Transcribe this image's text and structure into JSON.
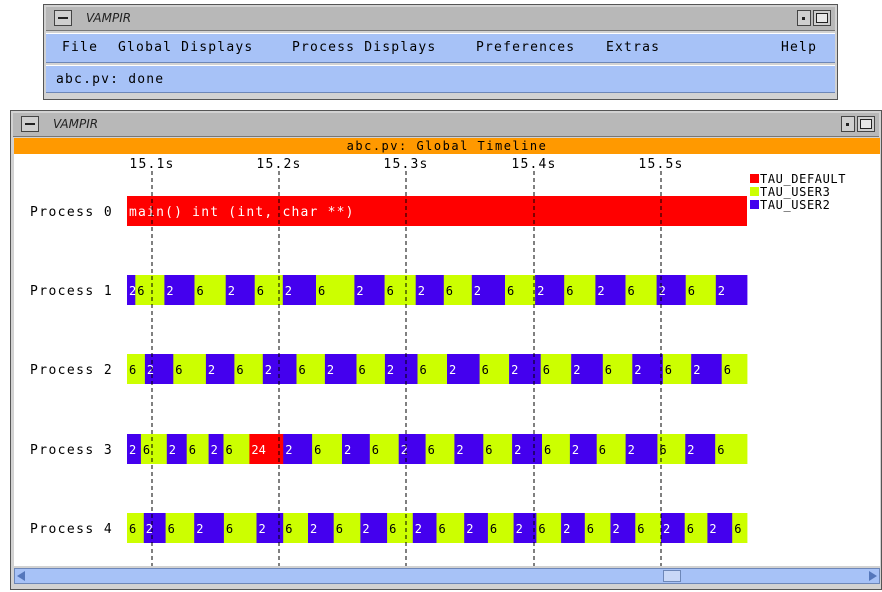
{
  "main_window": {
    "title": "VAMPIR",
    "menu": [
      "File",
      "Global Displays",
      "Process Displays",
      "Preferences",
      "Extras",
      "Help"
    ],
    "status": "abc.pv: done"
  },
  "timeline_window": {
    "title": "VAMPIR",
    "header": "abc.pv: Global Timeline",
    "ticks": [
      "15.1s",
      "15.2s",
      "15.3s",
      "15.4s",
      "15.5s"
    ],
    "legend": [
      {
        "name": "TAU_DEFAULT",
        "color": "#ff0000"
      },
      {
        "name": "TAU_USER3",
        "color": "#ccff00"
      },
      {
        "name": "TAU_USER2",
        "color": "#4400ee"
      }
    ],
    "main_label": "main() int (int, char **)",
    "rows": [
      {
        "label": "Process 0"
      },
      {
        "label": "Process 1"
      },
      {
        "label": "Process 2"
      },
      {
        "label": "Process 3"
      },
      {
        "label": "Process 4"
      }
    ],
    "seg_labels": {
      "user3": "6",
      "user2": "2",
      "special": "24"
    }
  }
}
